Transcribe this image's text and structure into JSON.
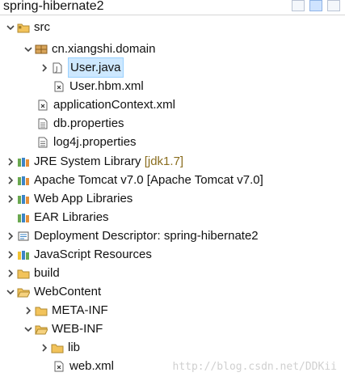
{
  "header": {
    "project_title": "spring-hibernate2"
  },
  "tree": {
    "src": "src",
    "package": "cn.xiangshi.domain",
    "user_java": "User.java",
    "user_hbm": "User.hbm.xml",
    "appctx": "applicationContext.xml",
    "dbprops": "db.properties",
    "log4j": "log4j.properties",
    "jre": "JRE System Library",
    "jre_decoration": "[jdk1.7]",
    "tomcat": "Apache Tomcat v7.0 [Apache Tomcat v7.0]",
    "webapp": "Web App Libraries",
    "ear": "EAR Libraries",
    "deploy": "Deployment Descriptor: spring-hibernate2",
    "jsres": "JavaScript Resources",
    "build": "build",
    "webcontent": "WebContent",
    "metainf": "META-INF",
    "webinf": "WEB-INF",
    "lib": "lib",
    "webxml": "web.xml"
  },
  "watermark": "http://blog.csdn.net/DDKii"
}
